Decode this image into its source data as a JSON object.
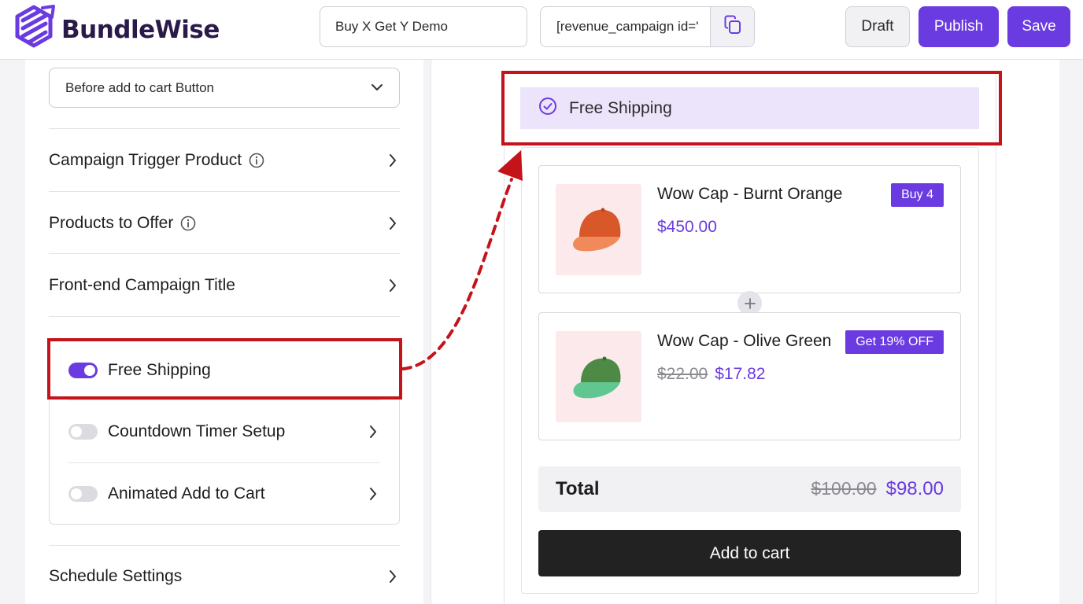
{
  "header": {
    "brand": "BundleWise",
    "campaign_name": "Buy X Get Y Demo",
    "shortcode": "[revenue_campaign id='",
    "draft_label": "Draft",
    "publish_label": "Publish",
    "save_label": "Save"
  },
  "sidebar": {
    "position_select": "Before add to cart Button",
    "sections": [
      {
        "label": "Campaign Trigger Product",
        "info": true
      },
      {
        "label": "Products to Offer",
        "info": true
      },
      {
        "label": "Front-end Campaign Title",
        "info": false
      }
    ],
    "toggles": [
      {
        "label": "Free Shipping",
        "on": true
      },
      {
        "label": "Countdown Timer Setup",
        "on": false
      },
      {
        "label": "Animated Add to Cart",
        "on": false
      }
    ],
    "schedule_label": "Schedule Settings"
  },
  "preview": {
    "free_shipping_text": "Free Shipping",
    "products": [
      {
        "title": "Wow Cap - Burnt Orange",
        "price": "$450.00",
        "old_price": "",
        "badge": "Buy 4",
        "cap_color": "#d9582a",
        "brim_color": "#f08a5a"
      },
      {
        "title": "Wow Cap - Olive Green",
        "price": "$17.82",
        "old_price": "$22.00",
        "badge": "Get 19% OFF",
        "cap_color": "#4e8a45",
        "brim_color": "#5fc78f"
      }
    ],
    "total_label": "Total",
    "total_old": "$100.00",
    "total_new": "$98.00",
    "add_to_cart_label": "Add to cart"
  },
  "colors": {
    "accent": "#6a3be0",
    "annotation": "#c4141a",
    "banner_bg": "#ece4fb"
  }
}
